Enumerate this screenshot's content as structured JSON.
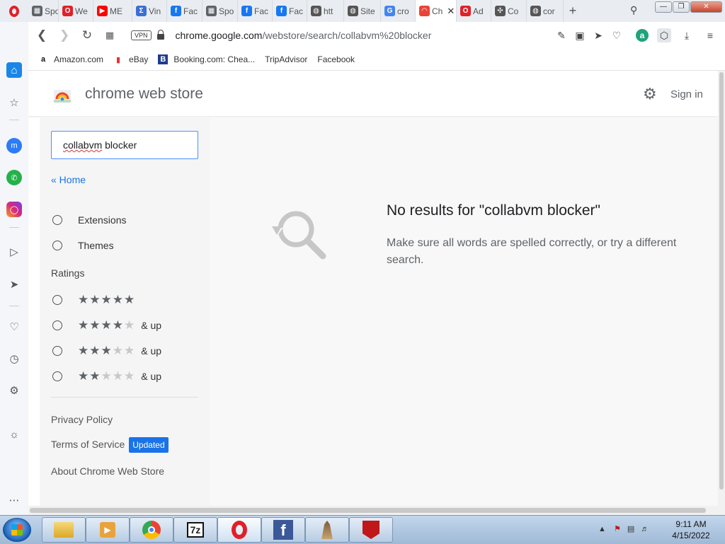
{
  "browser": {
    "tabs": [
      {
        "label": "Spo",
        "icon": "grid-icon",
        "color": "#5f6368"
      },
      {
        "label": "We",
        "icon": "opera-icon",
        "color": "#e0202a"
      },
      {
        "label": "ME",
        "icon": "youtube-icon",
        "color": "#ff0000"
      },
      {
        "label": "Vin",
        "icon": "sigma-icon",
        "color": "#3b6fd6"
      },
      {
        "label": "Fac",
        "icon": "facebook-icon",
        "color": "#1877f2"
      },
      {
        "label": "Spo",
        "icon": "grid-icon",
        "color": "#5f6368"
      },
      {
        "label": "Fac",
        "icon": "facebook-icon",
        "color": "#1877f2"
      },
      {
        "label": "Fac",
        "icon": "facebook-icon",
        "color": "#1877f2"
      },
      {
        "label": "htt",
        "icon": "globe-icon",
        "color": "#555555"
      },
      {
        "label": "Site",
        "icon": "globe-icon",
        "color": "#555555"
      },
      {
        "label": "cro",
        "icon": "google-icon",
        "color": "#4285f4"
      },
      {
        "label": "Ch",
        "icon": "webstore-icon",
        "color": "#ea4335",
        "active": true
      },
      {
        "label": "Ad",
        "icon": "opera-icon",
        "color": "#e0202a"
      },
      {
        "label": "Co",
        "icon": "puzzle-icon",
        "color": "#555555"
      },
      {
        "label": "cor",
        "icon": "globe-icon",
        "color": "#555555"
      }
    ],
    "new_tab_label": "+",
    "address": {
      "vpn_label": "VPN",
      "url_host": "chrome.google.com",
      "url_path": "/webstore/search/collabvm%20blocker"
    },
    "bookmarks": [
      {
        "label": "Amazon.com",
        "icon": "amazon-icon"
      },
      {
        "label": "eBay",
        "icon": "ebay-icon"
      },
      {
        "label": "Booking.com: Chea...",
        "icon": "booking-icon"
      },
      {
        "label": "TripAdvisor",
        "icon": "page-icon"
      },
      {
        "label": "Facebook",
        "icon": "page-icon"
      }
    ]
  },
  "store": {
    "title": "chrome web store",
    "sign_in": "Sign in",
    "search_value": "collabvm blocker",
    "home_link": "« Home",
    "categories": [
      "Extensions",
      "Themes"
    ],
    "ratings_heading": "Ratings",
    "ratings": [
      {
        "stars": 5,
        "suffix": ""
      },
      {
        "stars": 4,
        "suffix": "& up"
      },
      {
        "stars": 3,
        "suffix": "& up"
      },
      {
        "stars": 2,
        "suffix": "& up"
      }
    ],
    "footer": {
      "privacy": "Privacy Policy",
      "terms": "Terms of Service",
      "terms_badge": "Updated",
      "about": "About Chrome Web Store"
    },
    "no_results_title": "No results for \"collabvm blocker\"",
    "no_results_text": "Make sure all words are spelled correctly, or try a different search."
  },
  "taskbar": {
    "apps": [
      "file-explorer-icon",
      "media-player-icon",
      "chrome-icon",
      "7zip-icon",
      "opera-icon",
      "facebook-icon",
      "network-icon",
      "mcafee-icon"
    ],
    "sevenzip_label": "7z",
    "time": "9:11 AM",
    "date": "4/15/2022"
  },
  "colors": {
    "accent": "#1a73e8",
    "badge": "#1a73e8",
    "opera_red": "#e0202a"
  }
}
